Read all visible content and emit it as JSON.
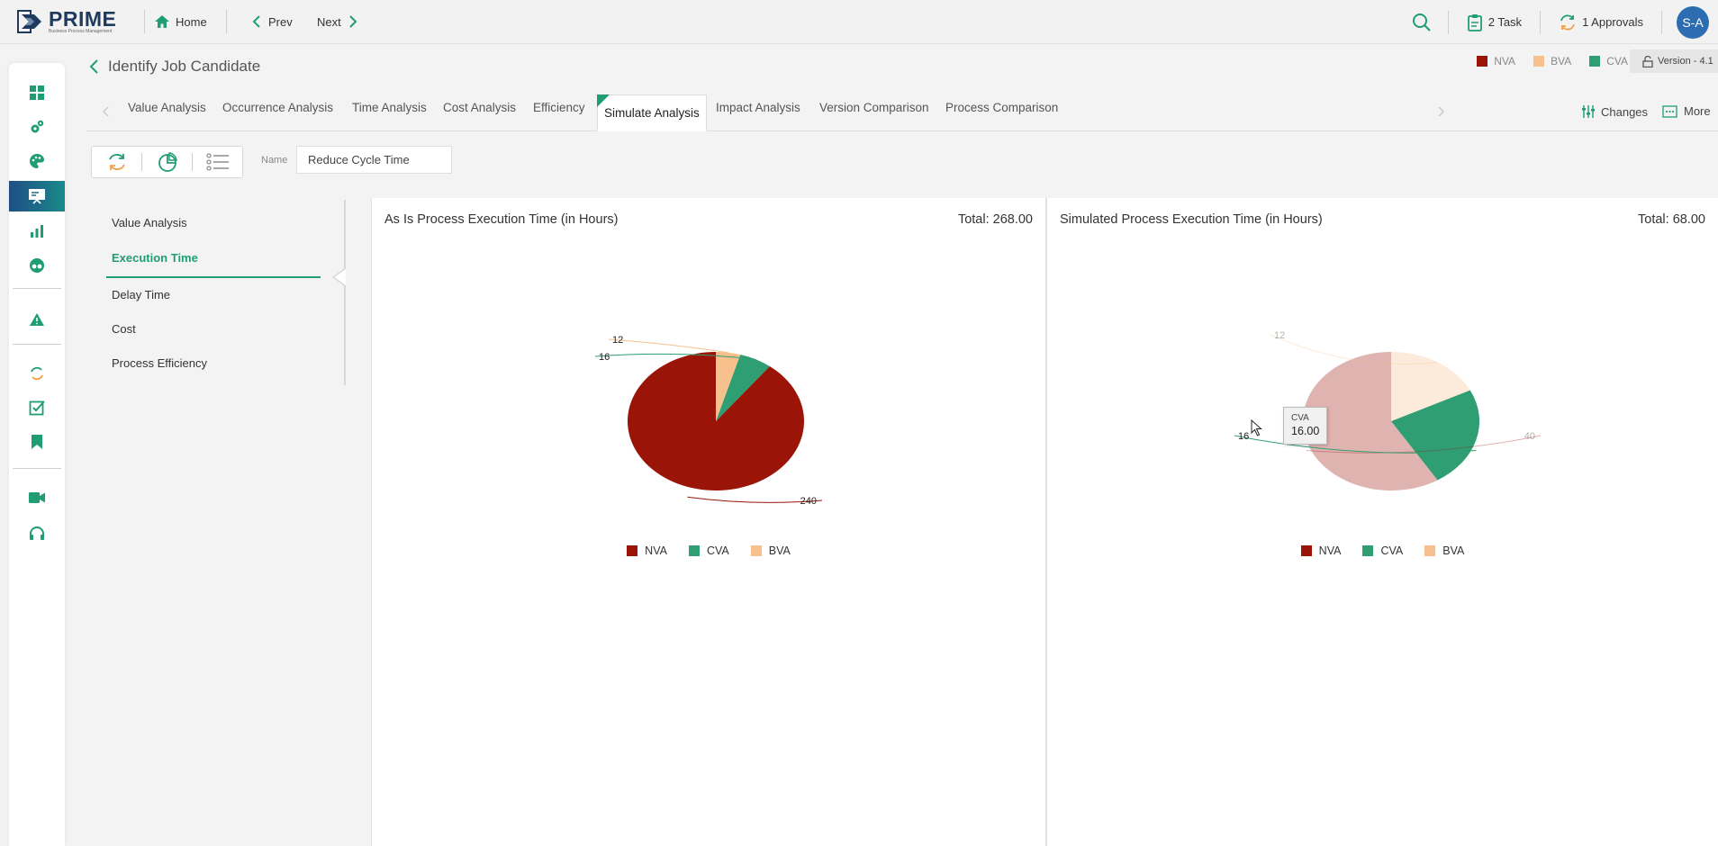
{
  "app": {
    "name": "PRIME",
    "tagline": "Business Process Management"
  },
  "topbar": {
    "home": "Home",
    "prev": "Prev",
    "next": "Next",
    "tasks": "2 Task",
    "approvals": "1 Approvals",
    "user_initials": "S-A"
  },
  "page": {
    "title": "Identify Job Candidate",
    "version": "Version - 4.1",
    "legend": [
      {
        "label": "NVA",
        "color": "#9b1408"
      },
      {
        "label": "BVA",
        "color": "#f7c08d"
      },
      {
        "label": "CVA",
        "color": "#2f9e73"
      }
    ]
  },
  "tabs": [
    "Value Analysis",
    "Occurrence Analysis",
    "Time Analysis",
    "Cost Analysis",
    "Efficiency",
    "Simulate Analysis",
    "Impact Analysis",
    "Version Comparison",
    "Process Comparison"
  ],
  "active_tab": "Simulate Analysis",
  "tab_tools": {
    "changes": "Changes",
    "more": "More"
  },
  "toolbar": {
    "name_label": "Name",
    "name_value": "Reduce Cycle Time"
  },
  "side_menu": [
    "Value Analysis",
    "Execution Time",
    "Delay Time",
    "Cost",
    "Process Efficiency"
  ],
  "active_menu": "Execution Time",
  "chart_legend": [
    {
      "label": "NVA",
      "color": "#9b1408"
    },
    {
      "label": "CVA",
      "color": "#2f9e73"
    },
    {
      "label": "BVA",
      "color": "#f7c08d"
    }
  ],
  "chart_data": [
    {
      "type": "pie",
      "title": "As Is Process Execution Time (in Hours)",
      "total_label": "Total: 268.00",
      "slices": [
        {
          "name": "NVA",
          "value": 240,
          "label": "240",
          "color": "#9b1408"
        },
        {
          "name": "CVA",
          "value": 16,
          "label": "16",
          "color": "#2f9e73"
        },
        {
          "name": "BVA",
          "value": 12,
          "label": "12",
          "color": "#f7c08d"
        }
      ],
      "legend": [
        "NVA",
        "CVA",
        "BVA"
      ],
      "legend_position": "bottom"
    },
    {
      "type": "pie",
      "title": "Simulated Process Execution Time (in Hours)",
      "total_label": "Total: 68.00",
      "slices": [
        {
          "name": "NVA",
          "value": 40,
          "label": "40",
          "color": "#9b1408"
        },
        {
          "name": "CVA",
          "value": 16,
          "label": "16",
          "color": "#2f9e73"
        },
        {
          "name": "BVA",
          "value": 12,
          "label": "12",
          "color": "#f7c08d"
        }
      ],
      "legend": [
        "NVA",
        "CVA",
        "BVA"
      ],
      "legend_position": "bottom",
      "highlighted": "CVA",
      "tooltip": {
        "name": "CVA",
        "value": "16.00"
      }
    }
  ]
}
